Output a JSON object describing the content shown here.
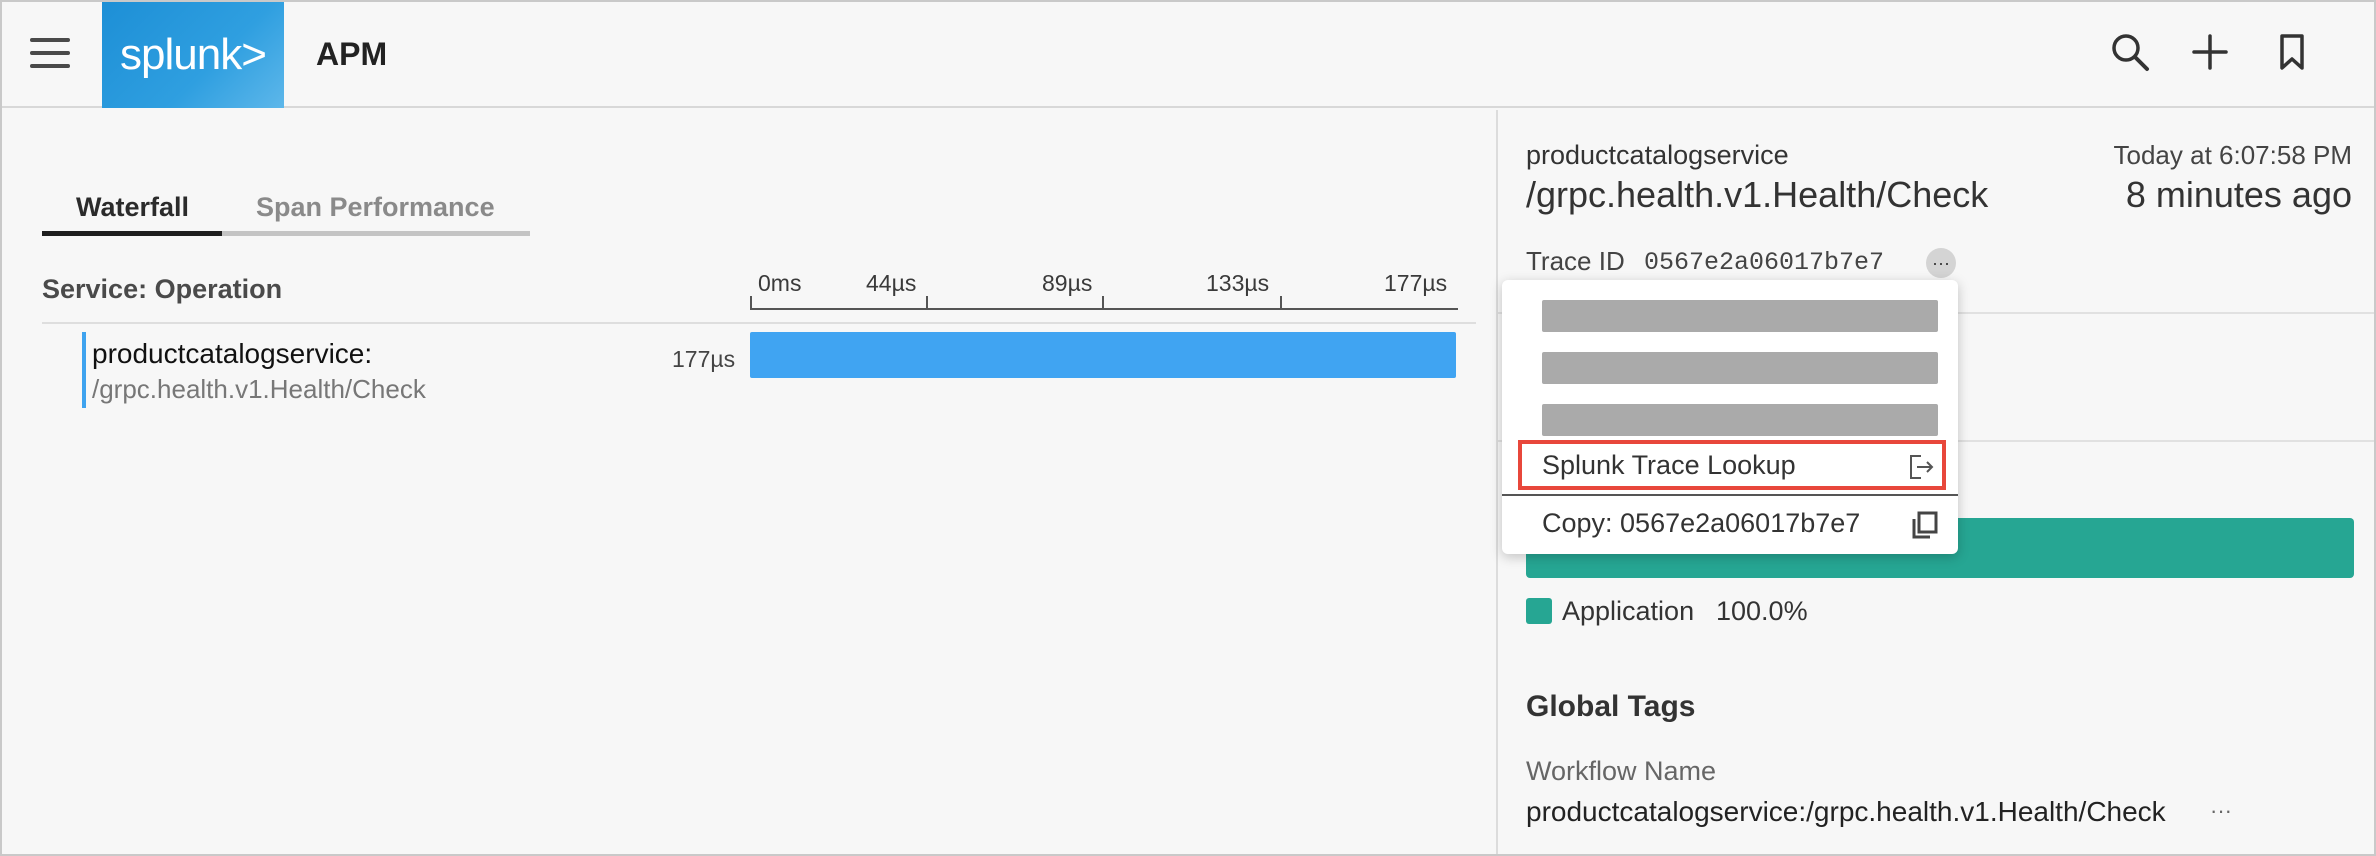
{
  "header": {
    "menu_icon": "hamburger-menu-icon",
    "logo_text": "splunk>",
    "title": "APM",
    "icons": [
      "search-icon",
      "plus-icon",
      "bookmark-icon"
    ]
  },
  "waterfall": {
    "tabs": [
      {
        "label": "Waterfall",
        "active": true
      },
      {
        "label": "Span Performance",
        "active": false
      }
    ],
    "column_header": "Service: Operation",
    "axis_ticks": [
      "0ms",
      "44µs",
      "89µs",
      "133µs",
      "177µs"
    ],
    "span": {
      "service": "productcatalogservice:",
      "operation": "/grpc.health.v1.Health/Check",
      "duration": "177µs",
      "fraction_of_trace": 1.0
    }
  },
  "detail": {
    "service": "productcatalogservice",
    "operation": "/grpc.health.v1.Health/Check",
    "timestamp": "Today at 6:07:58 PM",
    "relative_time": "8 minutes ago",
    "trace_id_label": "Trace ID",
    "trace_id": "0567e2a06017b7e7",
    "more_button": "···",
    "breakdown": [
      {
        "name": "Application",
        "percent": "100.0%",
        "color": "#26a693"
      }
    ],
    "global_tags_title": "Global Tags",
    "tag_key": "Workflow Name",
    "tag_value": "productcatalogservice:/grpc.health.v1.Health/Check",
    "tag_more": "···"
  },
  "trace_menu": {
    "redacted_item_count": 3,
    "lookup_label": "Splunk Trace Lookup",
    "lookup_icon": "external-link-icon",
    "copy_label": "Copy:  0567e2a06017b7e7",
    "copy_icon": "copy-icon"
  },
  "colors": {
    "span_bar": "#40a4f2",
    "application": "#26a693",
    "highlight_box": "#e8473b",
    "logo": "#1d8fd6"
  }
}
